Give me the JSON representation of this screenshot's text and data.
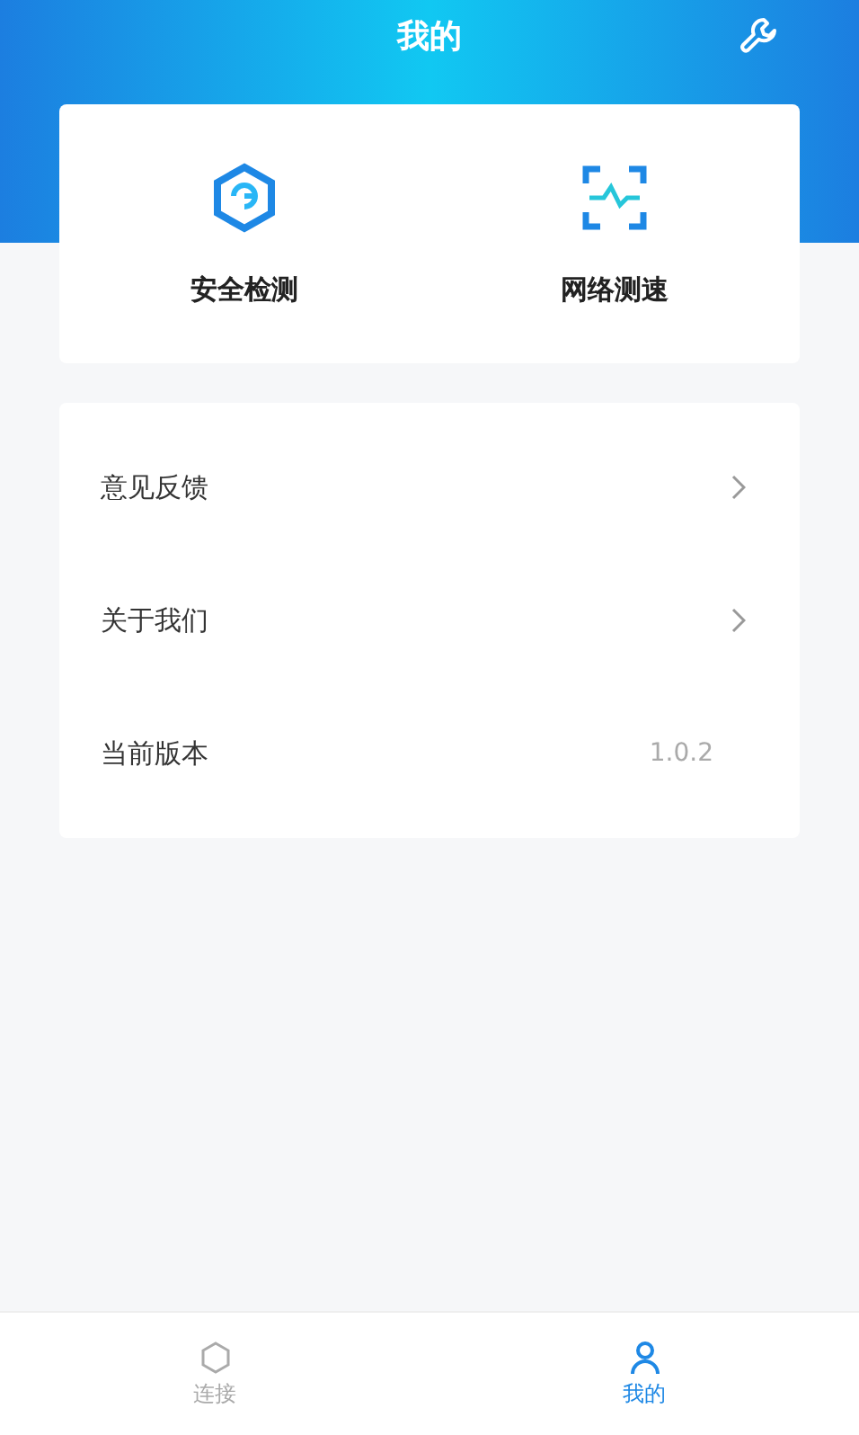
{
  "header": {
    "title": "我的"
  },
  "tools": [
    {
      "kind": "shield",
      "label": "安全检测"
    },
    {
      "kind": "scan",
      "label": "网络测速"
    }
  ],
  "menu": [
    {
      "label": "意见反馈",
      "kind": "link"
    },
    {
      "label": "关于我们",
      "kind": "link"
    },
    {
      "label": "当前版本",
      "kind": "value",
      "value": "1.0.2"
    }
  ],
  "tabs": [
    {
      "label": "连接",
      "kind": "connect",
      "selected": false
    },
    {
      "label": "我的",
      "kind": "me",
      "selected": true
    }
  ]
}
